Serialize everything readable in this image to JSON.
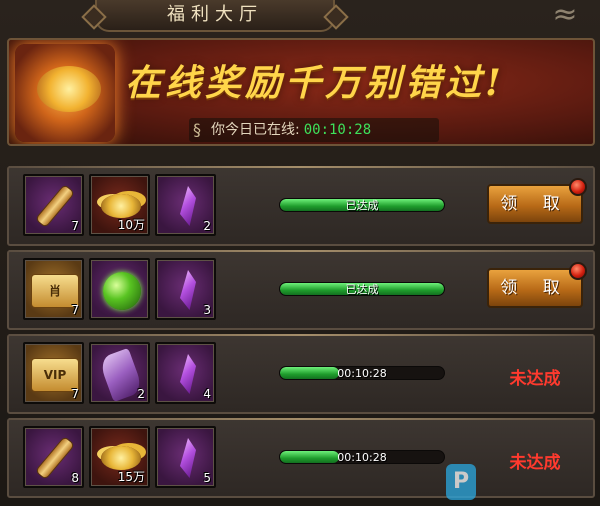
{
  "header": {
    "title": "福利大厅"
  },
  "banner": {
    "slogan": "在线奖励千万别错过!",
    "online_label": "你今日已在线:",
    "online_time": "00:10:28"
  },
  "rows": [
    {
      "items": [
        {
          "icon": "scroll-icon",
          "count": "7"
        },
        {
          "icon": "gold-coins-icon",
          "count": "10万"
        },
        {
          "icon": "purple-gem-icon",
          "count": "2"
        }
      ],
      "progress_text": "已达成",
      "progress": 1.0,
      "action_type": "button",
      "action_label": "领 取"
    },
    {
      "items": [
        {
          "icon": "ticket-icon",
          "count": "7",
          "glyph": "肖"
        },
        {
          "icon": "green-orb-icon",
          "count": ""
        },
        {
          "icon": "purple-gem-icon",
          "count": "3"
        }
      ],
      "progress_text": "已达成",
      "progress": 1.0,
      "action_type": "button",
      "action_label": "领 取"
    },
    {
      "items": [
        {
          "icon": "vip-ticket-icon",
          "count": "7",
          "glyph": "VIP"
        },
        {
          "icon": "ribbon-icon",
          "count": "2"
        },
        {
          "icon": "purple-gem-icon",
          "count": "4"
        }
      ],
      "progress_text": "00:10:28",
      "progress": 0.36,
      "action_type": "status",
      "action_label": "未达成"
    },
    {
      "items": [
        {
          "icon": "scroll-icon",
          "count": "8"
        },
        {
          "icon": "gold-coins-icon",
          "count": "15万"
        },
        {
          "icon": "purple-gem-icon",
          "count": "5"
        }
      ],
      "progress_text": "00:10:28",
      "progress": 0.36,
      "action_type": "status",
      "action_label": "未达成"
    }
  ],
  "colors": {
    "accent_green": "#3ee05a",
    "not_reached_red": "#ff3a2e",
    "button_orange": "#e9a23e"
  }
}
